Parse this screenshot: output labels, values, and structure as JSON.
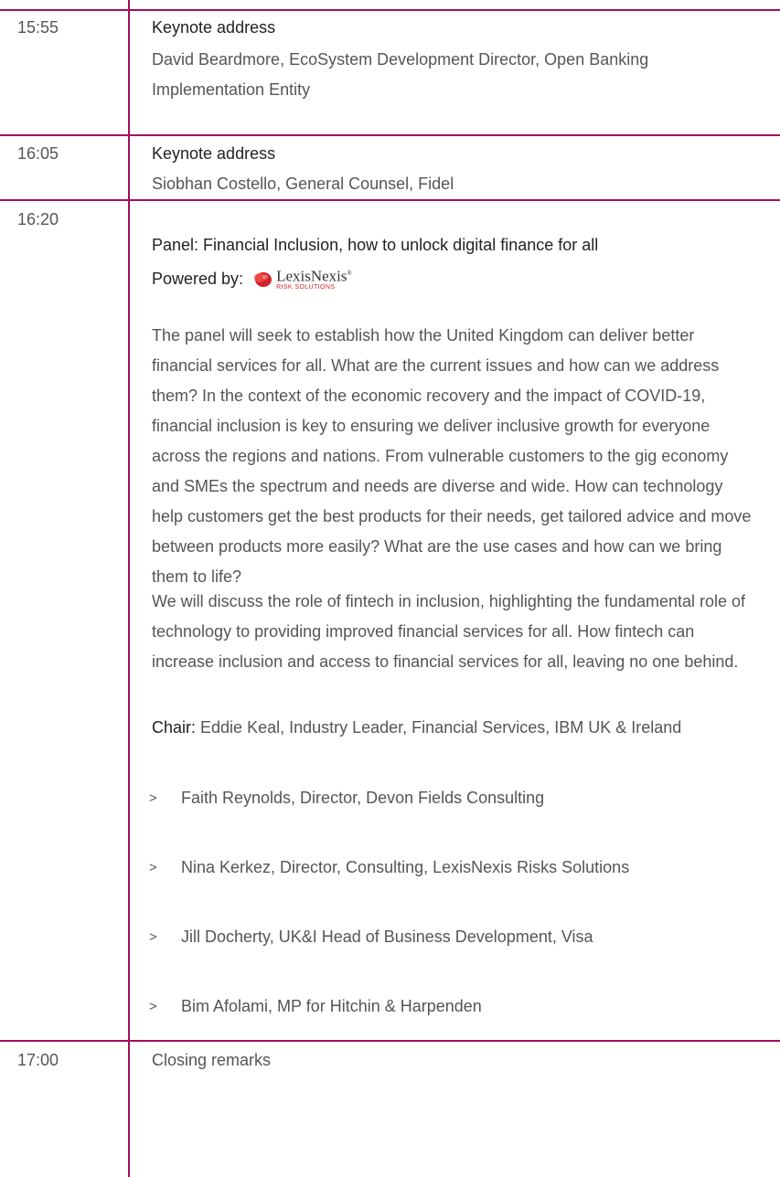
{
  "sessions": [
    {
      "time": "15:55",
      "title": "Keynote address",
      "speaker": "David Beardmore, EcoSystem Development Director, Open Banking Implementation Entity"
    },
    {
      "time": "16:05",
      "title": "Keynote address",
      "speaker": "Siobhan Costello, General Counsel, Fidel"
    },
    {
      "time": "16:20",
      "title": "Panel: Financial Inclusion, how to unlock digital finance for all",
      "powered_by_label": "Powered by:",
      "sponsor": {
        "name": "LexisNexis",
        "tagline": "RISK SOLUTIONS",
        "mark": "®",
        "logo_color": "#d2232a"
      },
      "description_paragraphs": [
        "The panel will seek to establish how the United Kingdom can deliver better financial services for all. What are the current issues and how can we address them? In the context of the economic recovery and the impact of COVID-19, financial inclusion is key to ensuring we deliver inclusive growth for everyone across the regions and nations. From vulnerable customers to the gig economy and SMEs the spectrum and needs are diverse and wide.  How can technology help customers get the best products for their needs, get tailored advice and move between products more easily? What are the use cases and how can we bring them to life?",
        "We will discuss the role of fintech in inclusion, highlighting the fundamental role of technology to providing improved financial services for all. How fintech can increase inclusion and access to financial services for all, leaving no one behind."
      ],
      "chair_label": "Chair:",
      "chair": "Eddie Keal, Industry Leader, Financial Services, IBM UK & Ireland",
      "bullet": ">",
      "panelists": [
        "Faith Reynolds, Director, Devon Fields Consulting",
        "Nina Kerkez, Director, Consulting, LexisNexis Risks Solutions",
        "Jill Docherty, UK&I Head of Business Development, Visa",
        "Bim Afolami, MP for Hitchin & Harpenden"
      ]
    },
    {
      "time": "17:00",
      "title": "Closing remarks"
    }
  ],
  "colors": {
    "rule": "#a50d5e",
    "body_text": "#555555",
    "title_text": "#222222"
  }
}
